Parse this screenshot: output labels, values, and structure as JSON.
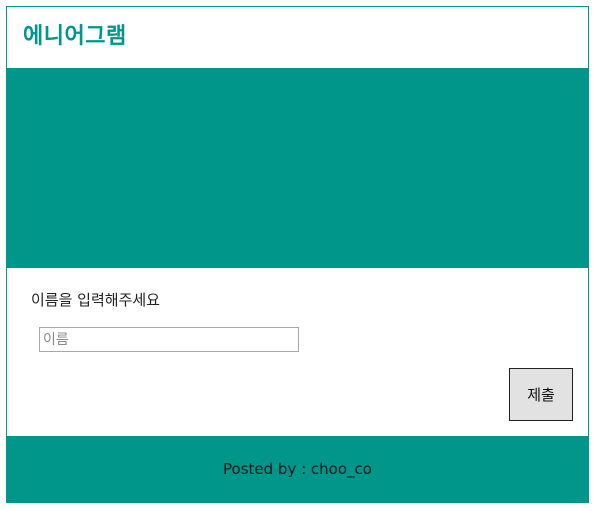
{
  "header": {
    "title": "에니어그램"
  },
  "form": {
    "prompt": "이름을 입력해주세요",
    "name_input": {
      "placeholder": "이름",
      "value": ""
    },
    "submit_label": "제출"
  },
  "footer": {
    "text": "Posted by : choo_co"
  },
  "colors": {
    "brand": "#00968a",
    "background": "#ffffff",
    "button_background": "#e2e2e2",
    "text": "#222222"
  }
}
